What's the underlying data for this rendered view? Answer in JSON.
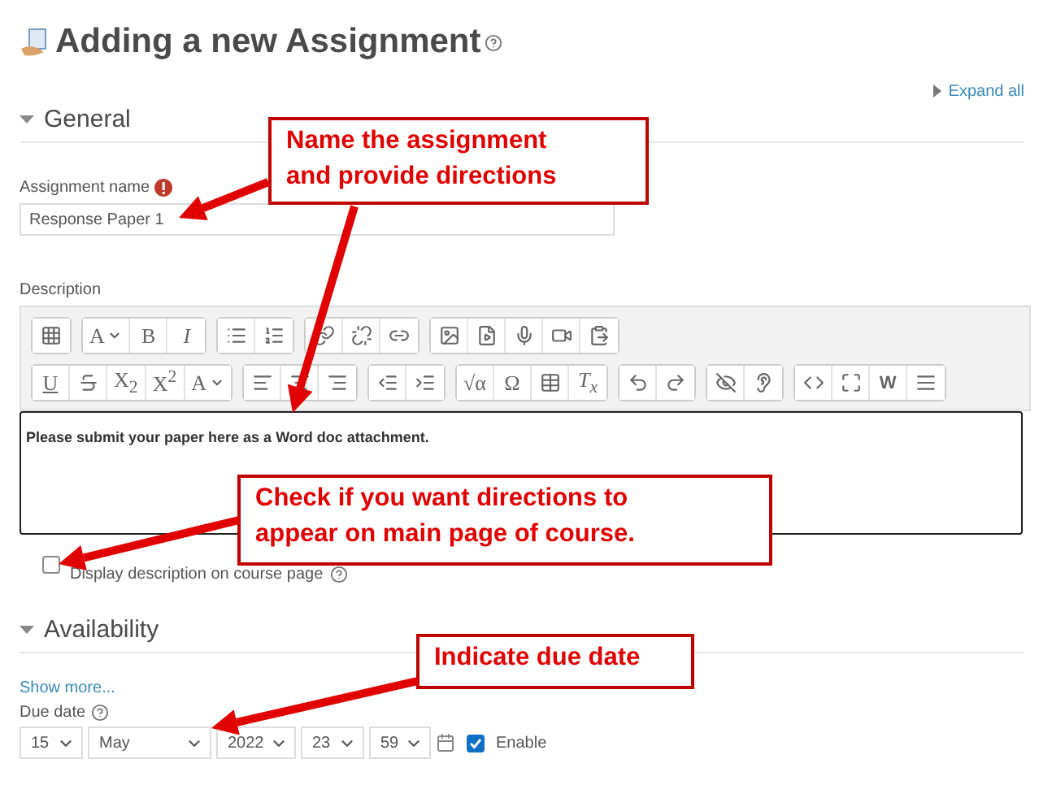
{
  "page_title": "Adding a new Assignment",
  "expand_all": "Expand all",
  "sections": [
    {
      "title": "General",
      "expanded": true
    },
    {
      "title": "Availability",
      "expanded": true
    }
  ],
  "assignment_name": {
    "label": "Assignment name",
    "value": "Response Paper 1"
  },
  "description": {
    "label": "Description",
    "content": "Please submit your paper here as a Word doc attachment.",
    "toolbar_rows": [
      [
        [
          {
            "kind": "grid"
          }
        ],
        [
          {
            "kind": "text",
            "label": "A",
            "dropdown": true
          },
          {
            "kind": "text",
            "label": "B"
          },
          {
            "kind": "text",
            "label": "I",
            "italic": true
          }
        ],
        [
          {
            "kind": "bullets"
          },
          {
            "kind": "numbers"
          }
        ],
        [
          {
            "kind": "link"
          },
          {
            "kind": "unlink"
          },
          {
            "kind": "chain"
          }
        ],
        [
          {
            "kind": "image"
          },
          {
            "kind": "media"
          },
          {
            "kind": "mic"
          },
          {
            "kind": "video"
          },
          {
            "kind": "clipboard"
          }
        ]
      ],
      [
        [
          {
            "kind": "text",
            "label": "U",
            "underline": true
          },
          {
            "kind": "strikethrough"
          },
          {
            "kind": "text",
            "label": "X$_{2}$"
          },
          {
            "kind": "text",
            "label": "X$^{2}$"
          },
          {
            "kind": "text",
            "label": "A",
            "dropdown": true
          }
        ],
        [
          {
            "kind": "align-left"
          },
          {
            "kind": "align-center"
          },
          {
            "kind": "align-right"
          }
        ],
        [
          {
            "kind": "outdent"
          },
          {
            "kind": "indent"
          }
        ],
        [
          {
            "kind": "text",
            "label": "√α"
          },
          {
            "kind": "text",
            "label": "Ω"
          },
          {
            "kind": "table"
          },
          {
            "kind": "text",
            "label": "T$_{x}$",
            "italic": true
          }
        ],
        [
          {
            "kind": "undo"
          },
          {
            "kind": "redo"
          }
        ],
        [
          {
            "kind": "eye-off"
          },
          {
            "kind": "ear"
          }
        ],
        [
          {
            "kind": "code"
          },
          {
            "kind": "fullscreen"
          },
          {
            "kind": "text",
            "label": "W",
            "boxed": true
          },
          {
            "kind": "rows"
          }
        ]
      ]
    ]
  },
  "display_description": {
    "label": "Display description on course page",
    "checked": false
  },
  "show_more": "Show more...",
  "due_date": {
    "label": "Due date",
    "day": "15",
    "month": "May",
    "year": "2022",
    "hour": "23",
    "minute": "59",
    "enable_label": "Enable",
    "enabled": true
  },
  "callouts": [
    [
      "Name the assignment",
      "and provide directions"
    ],
    [
      "Check if you want directions to",
      "appear on main page of course."
    ],
    [
      "Indicate due date"
    ]
  ]
}
